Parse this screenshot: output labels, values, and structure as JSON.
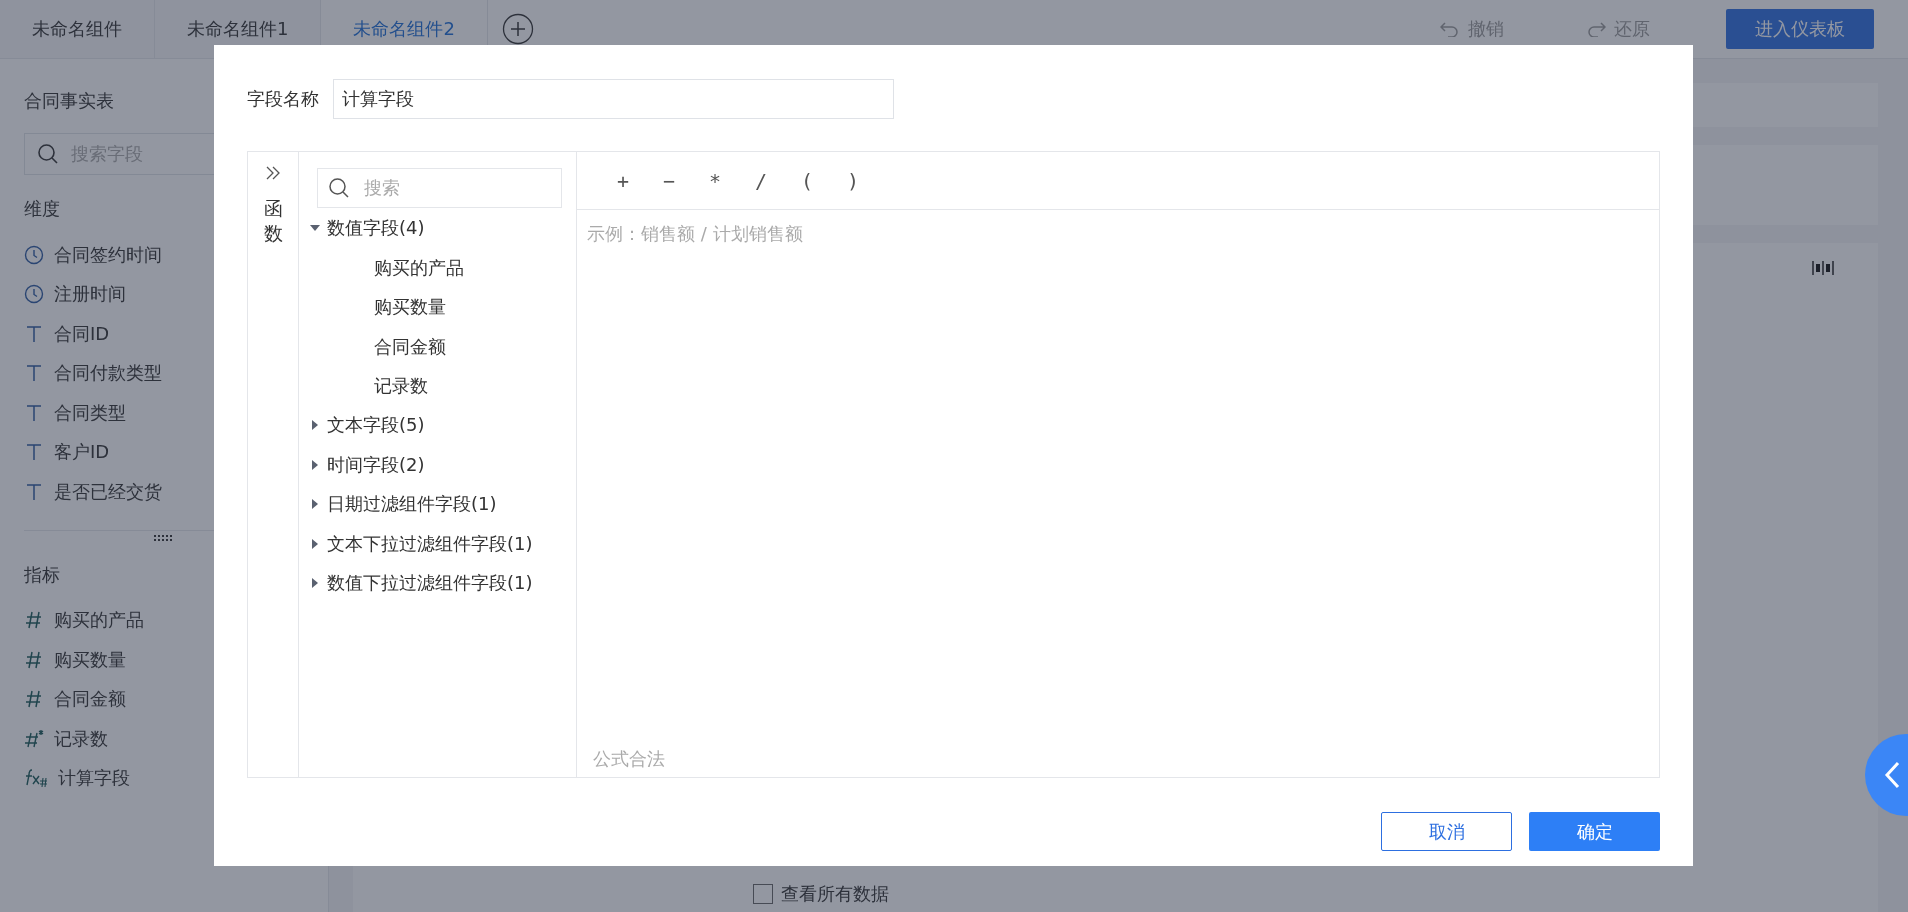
{
  "tabs": [
    {
      "label": "未命名组件",
      "selected": false
    },
    {
      "label": "未命名组件1",
      "selected": false
    },
    {
      "label": "未命名组件2",
      "selected": true
    }
  ],
  "toolbar": {
    "undo": "撤销",
    "redo": "还原",
    "primary_button": "进入仪表板"
  },
  "sidebar": {
    "table_name": "合同事实表",
    "search": {
      "placeholder": "搜索字段"
    },
    "dimensions": {
      "title": "维度",
      "items": [
        {
          "label": "合同签约时间",
          "kind": "time"
        },
        {
          "label": "注册时间",
          "kind": "time"
        },
        {
          "label": "合同ID",
          "kind": "text"
        },
        {
          "label": "合同付款类型",
          "kind": "text"
        },
        {
          "label": "合同类型",
          "kind": "text"
        },
        {
          "label": "客户ID",
          "kind": "text"
        },
        {
          "label": "是否已经交货",
          "kind": "text"
        }
      ]
    },
    "measures": {
      "title": "指标",
      "items": [
        {
          "label": "购买的产品",
          "kind": "number"
        },
        {
          "label": "购买数量",
          "kind": "number"
        },
        {
          "label": "合同金额",
          "kind": "number"
        },
        {
          "label": "记录数",
          "kind": "count"
        },
        {
          "label": "计算字段",
          "kind": "calculated"
        }
      ]
    }
  },
  "view_all_checkbox": {
    "label": "查看所有数据",
    "checked": false
  },
  "dialog": {
    "field_name_label": "字段名称",
    "field_name_value": "计算字段",
    "function_tab": "函数",
    "search": {
      "placeholder": "搜索"
    },
    "groups": [
      {
        "label": "数值字段(4)",
        "expanded": true,
        "children": [
          {
            "label": "购买的产品"
          },
          {
            "label": "购买数量"
          },
          {
            "label": "合同金额"
          },
          {
            "label": "记录数"
          }
        ]
      },
      {
        "label": "文本字段(5)",
        "expanded": false
      },
      {
        "label": "时间字段(2)",
        "expanded": false
      },
      {
        "label": "日期过滤组件字段(1)",
        "expanded": false
      },
      {
        "label": "文本下拉过滤组件字段(1)",
        "expanded": false
      },
      {
        "label": "数值下拉过滤组件字段(1)",
        "expanded": false
      }
    ],
    "operators": [
      "+",
      "−",
      "*",
      "/",
      "(",
      ")"
    ],
    "editor": {
      "placeholder": "示例：销售额 / 计划销售额"
    },
    "status": "公式合法",
    "cancel": "取消",
    "confirm": "确定"
  }
}
